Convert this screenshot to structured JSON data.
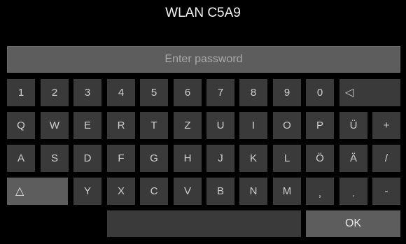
{
  "title": "WLAN C5A9",
  "password": {
    "placeholder": "Enter password"
  },
  "rows": [
    [
      "1",
      "2",
      "3",
      "4",
      "5",
      "6",
      "7",
      "8",
      "9",
      "0",
      "◁"
    ],
    [
      "Q",
      "W",
      "E",
      "R",
      "T",
      "Z",
      "U",
      "I",
      "O",
      "P",
      "Ü",
      "+"
    ],
    [
      "A",
      "S",
      "D",
      "F",
      "G",
      "H",
      "J",
      "K",
      "L",
      "Ö",
      "Ä",
      "/"
    ],
    [
      "△",
      "Y",
      "X",
      "C",
      "V",
      "B",
      "N",
      "M",
      ",",
      ".",
      "-"
    ],
    [
      "OK"
    ]
  ],
  "colors": {
    "background": "#000000",
    "key": "#3a3a3a",
    "key_light": "#5d5d5d",
    "text": "#cfcfcf"
  }
}
